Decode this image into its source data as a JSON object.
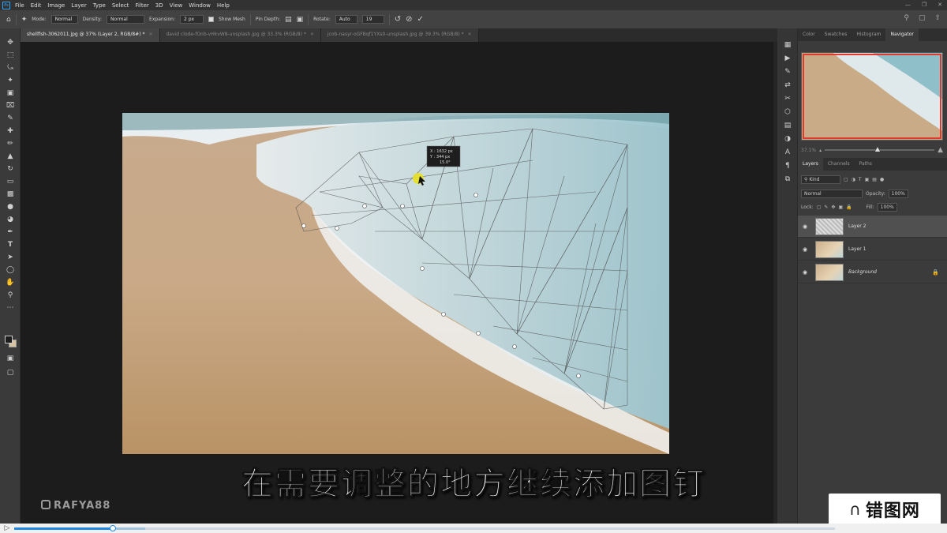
{
  "app": {
    "logo_text": "Ps"
  },
  "menu": [
    "File",
    "Edit",
    "Image",
    "Layer",
    "Type",
    "Select",
    "Filter",
    "3D",
    "View",
    "Window",
    "Help"
  ],
  "options": {
    "mode_label": "Mode:",
    "mode_value": "Normal",
    "density_label": "Density:",
    "density_value": "Normal",
    "expansion_label": "Expansion:",
    "expansion_value": "2 px",
    "show_mesh_label": "Show Mesh",
    "pin_depth_label": "Pin Depth:",
    "rotate_label": "Rotate:",
    "rotate_value": "Auto",
    "angle_value": "19"
  },
  "tabs": [
    {
      "label": "shellfish-3062011.jpg @ 37% (Layer 2, RGB/8#) *",
      "active": true
    },
    {
      "label": "david clode-fOnb-vHkvW8-unsplash.jpg @ 33.3% (RGB/8) *",
      "active": false
    },
    {
      "label": "jcob-nasyr-oGFBqf1YXs0-unsplash.jpg @ 39.3% (RGB/8) *",
      "active": false
    }
  ],
  "tooltip": {
    "x_line": "X :  1632 px",
    "y_line": "Y :    344 px",
    "angle_line": "15.0°"
  },
  "panels": {
    "top_tabs": [
      "Color",
      "Swatches",
      "Histogram",
      "Navigator"
    ],
    "active_top_tab": "Navigator",
    "zoom_label": "37.1%",
    "layer_tabs": [
      "Layers",
      "Channels",
      "Paths"
    ],
    "kind_label": "Kind",
    "blend_mode": "Normal",
    "opacity_label": "Opacity:",
    "opacity_value": "100%",
    "lock_label": "Lock:",
    "fill_label": "Fill:",
    "fill_value": "100%",
    "layers": [
      {
        "name": "Layer 2",
        "selected": true,
        "thumb": "mesh"
      },
      {
        "name": "Layer 1",
        "selected": false,
        "thumb": "photo"
      },
      {
        "name": "Background",
        "selected": false,
        "thumb": "photo",
        "locked": true
      }
    ]
  },
  "subtitle": "在需要调整的地方继续添加图钉",
  "watermark": "RAFYA88",
  "site_logo": "错图网",
  "player": {
    "progress": 0.12,
    "buffered": 0.16
  },
  "colors": {
    "accent": "#31a8ff",
    "nav_frame": "#e03a2f",
    "progress": "#1e88e5",
    "pin_highlight": "#e8e020"
  }
}
